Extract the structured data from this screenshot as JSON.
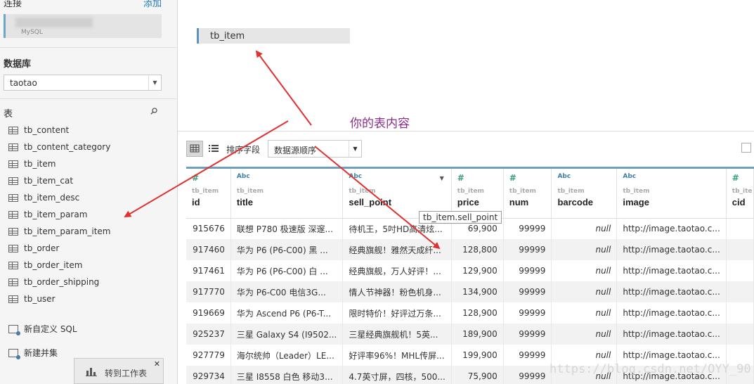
{
  "sidebar": {
    "connection_title": "连接",
    "add_label": "添加",
    "connection_sub": "MySQL",
    "database_title": "数据库",
    "database_value": "taotao",
    "tables_title": "表",
    "tables": [
      "tb_content",
      "tb_content_category",
      "tb_item",
      "tb_item_cat",
      "tb_item_desc",
      "tb_item_param",
      "tb_item_param_item",
      "tb_order",
      "tb_order_item",
      "tb_order_shipping",
      "tb_user"
    ],
    "custom_sql": "新自定义 SQL",
    "new_union": "新建并集",
    "goto_sheet": "转到工作表"
  },
  "canvas": {
    "table_name": "tb_item",
    "annotation": "你的表内容"
  },
  "toolbar": {
    "sort_label": "排序字段",
    "sort_value": "数据源顺序"
  },
  "grid": {
    "columns": [
      {
        "type": "#",
        "source": "tb_item",
        "name": "id"
      },
      {
        "type": "Abc",
        "source": "tb_item",
        "name": "title"
      },
      {
        "type": "Abc",
        "source": "tb_item",
        "name": "sell_point"
      },
      {
        "type": "#",
        "source": "tb_item",
        "name": "price"
      },
      {
        "type": "#",
        "source": "tb_item",
        "name": "num"
      },
      {
        "type": "Abc",
        "source": "tb_item",
        "name": "barcode"
      },
      {
        "type": "Abc",
        "source": "tb_item",
        "name": "image"
      },
      {
        "type": "#",
        "source": "tb_ite",
        "name": "cid"
      }
    ],
    "rows": [
      [
        "915676",
        "联想 P780 极速版 深邃...",
        "待机王，5吋HD高清炫...",
        "69,900",
        "99999",
        "null",
        "http://image.taotao.c...",
        ""
      ],
      [
        "917460",
        "华为 P6 (P6-C00) 黑 ...",
        "经典旗舰！雅然天成纤...",
        "128,800",
        "99999",
        "null",
        "http://image.taotao.c...",
        ""
      ],
      [
        "917461",
        "华为 P6 (P6-C00) 白 ...",
        "经典旗舰，万人好评！...",
        "129,900",
        "99999",
        "null",
        "http://image.taotao.c...",
        ""
      ],
      [
        "917770",
        "华为 P6-C00 电信3G...",
        "情人节神器！粉色机身...",
        "134,900",
        "99999",
        "null",
        "http://image.taotao.c...",
        ""
      ],
      [
        "919669",
        "华为 Ascend P6 (P6-T...",
        "限时特价！好评过万条...",
        "128,900",
        "99999",
        "null",
        "http://image.taotao.c...",
        ""
      ],
      [
        "925237",
        "三星 Galaxy S4 (I9502...",
        "三星经典旗舰机！5英...",
        "189,900",
        "99999",
        "null",
        "http://image.taotao.c...",
        ""
      ],
      [
        "927779",
        "海尔统帅（Leader）LE...",
        "好评率96%！MHL传屏...",
        "199,900",
        "99999",
        "null",
        "http://image.taotao.c...",
        ""
      ],
      [
        "929734",
        "三星 I8558 白色 移动3...",
        "4.7英寸屏，四核，500...",
        "75,900",
        "99999",
        "null",
        "http://image.taotao.c...",
        ""
      ]
    ],
    "tooltip": "tb_item.sell_point"
  },
  "watermark": "https://blog.csdn.net/OYY_90",
  "colors": {
    "accent": "#5c93c0",
    "arrow": "#e03030",
    "annotation": "#8a2e8a"
  }
}
